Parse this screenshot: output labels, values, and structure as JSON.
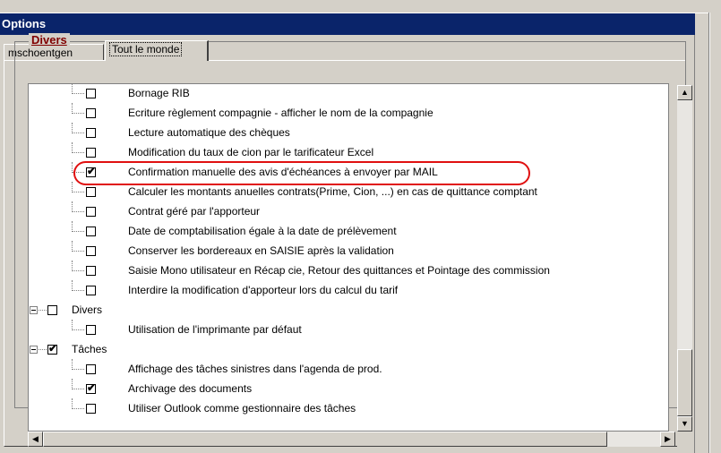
{
  "window": {
    "title": "Options"
  },
  "tabs": [
    {
      "label": "mschoentgen",
      "active": false
    },
    {
      "label": "Tout le monde",
      "active": true
    }
  ],
  "group": {
    "label": "Divers"
  },
  "tree": [
    {
      "label": "Bornage RIB",
      "checked": false,
      "level": 1
    },
    {
      "label": "Ecriture règlement compagnie - afficher le nom de la compagnie",
      "checked": false,
      "level": 1
    },
    {
      "label": "Lecture automatique des chèques",
      "checked": false,
      "level": 1
    },
    {
      "label": "Modification du taux de cion par le tarificateur Excel",
      "checked": false,
      "level": 1
    },
    {
      "label": "Confirmation manuelle des avis d'échéances à envoyer par MAIL",
      "checked": true,
      "level": 1,
      "highlighted": true
    },
    {
      "label": "Calculer les montants anuelles contrats(Prime, Cion, ...) en cas de quittance comptant",
      "checked": false,
      "level": 1
    },
    {
      "label": "Contrat géré par l'apporteur",
      "checked": false,
      "level": 1
    },
    {
      "label": "Date de comptabilisation égale à la date de prélèvement",
      "checked": false,
      "level": 1
    },
    {
      "label": "Conserver les bordereaux en SAISIE après la validation",
      "checked": false,
      "level": 1
    },
    {
      "label": "Saisie Mono utilisateur en Récap cie, Retour des quittances et Pointage des commission",
      "checked": false,
      "level": 1
    },
    {
      "label": "Interdire la modification d'apporteur lors du calcul du tarif",
      "checked": false,
      "level": 1
    },
    {
      "label": "Divers",
      "checked": false,
      "level": 0,
      "expander": true
    },
    {
      "label": "Utilisation de l'imprimante par défaut",
      "checked": false,
      "level": 1
    },
    {
      "label": "Tâches",
      "checked": true,
      "level": 0,
      "expander": true
    },
    {
      "label": "Affichage des tâches sinistres dans l'agenda de prod.",
      "checked": false,
      "level": 1
    },
    {
      "label": "Archivage des documents",
      "checked": true,
      "level": 1
    },
    {
      "label": "Utiliser Outlook comme gestionnaire des tâches",
      "checked": false,
      "level": 1
    }
  ],
  "icons": {
    "scroll_up": "▲",
    "scroll_down": "▼",
    "scroll_left": "◀",
    "scroll_right": "▶",
    "check": "✔"
  },
  "colors": {
    "titlebar": "#0a246a",
    "group_label": "#800000",
    "highlight_ring": "#e01010"
  }
}
